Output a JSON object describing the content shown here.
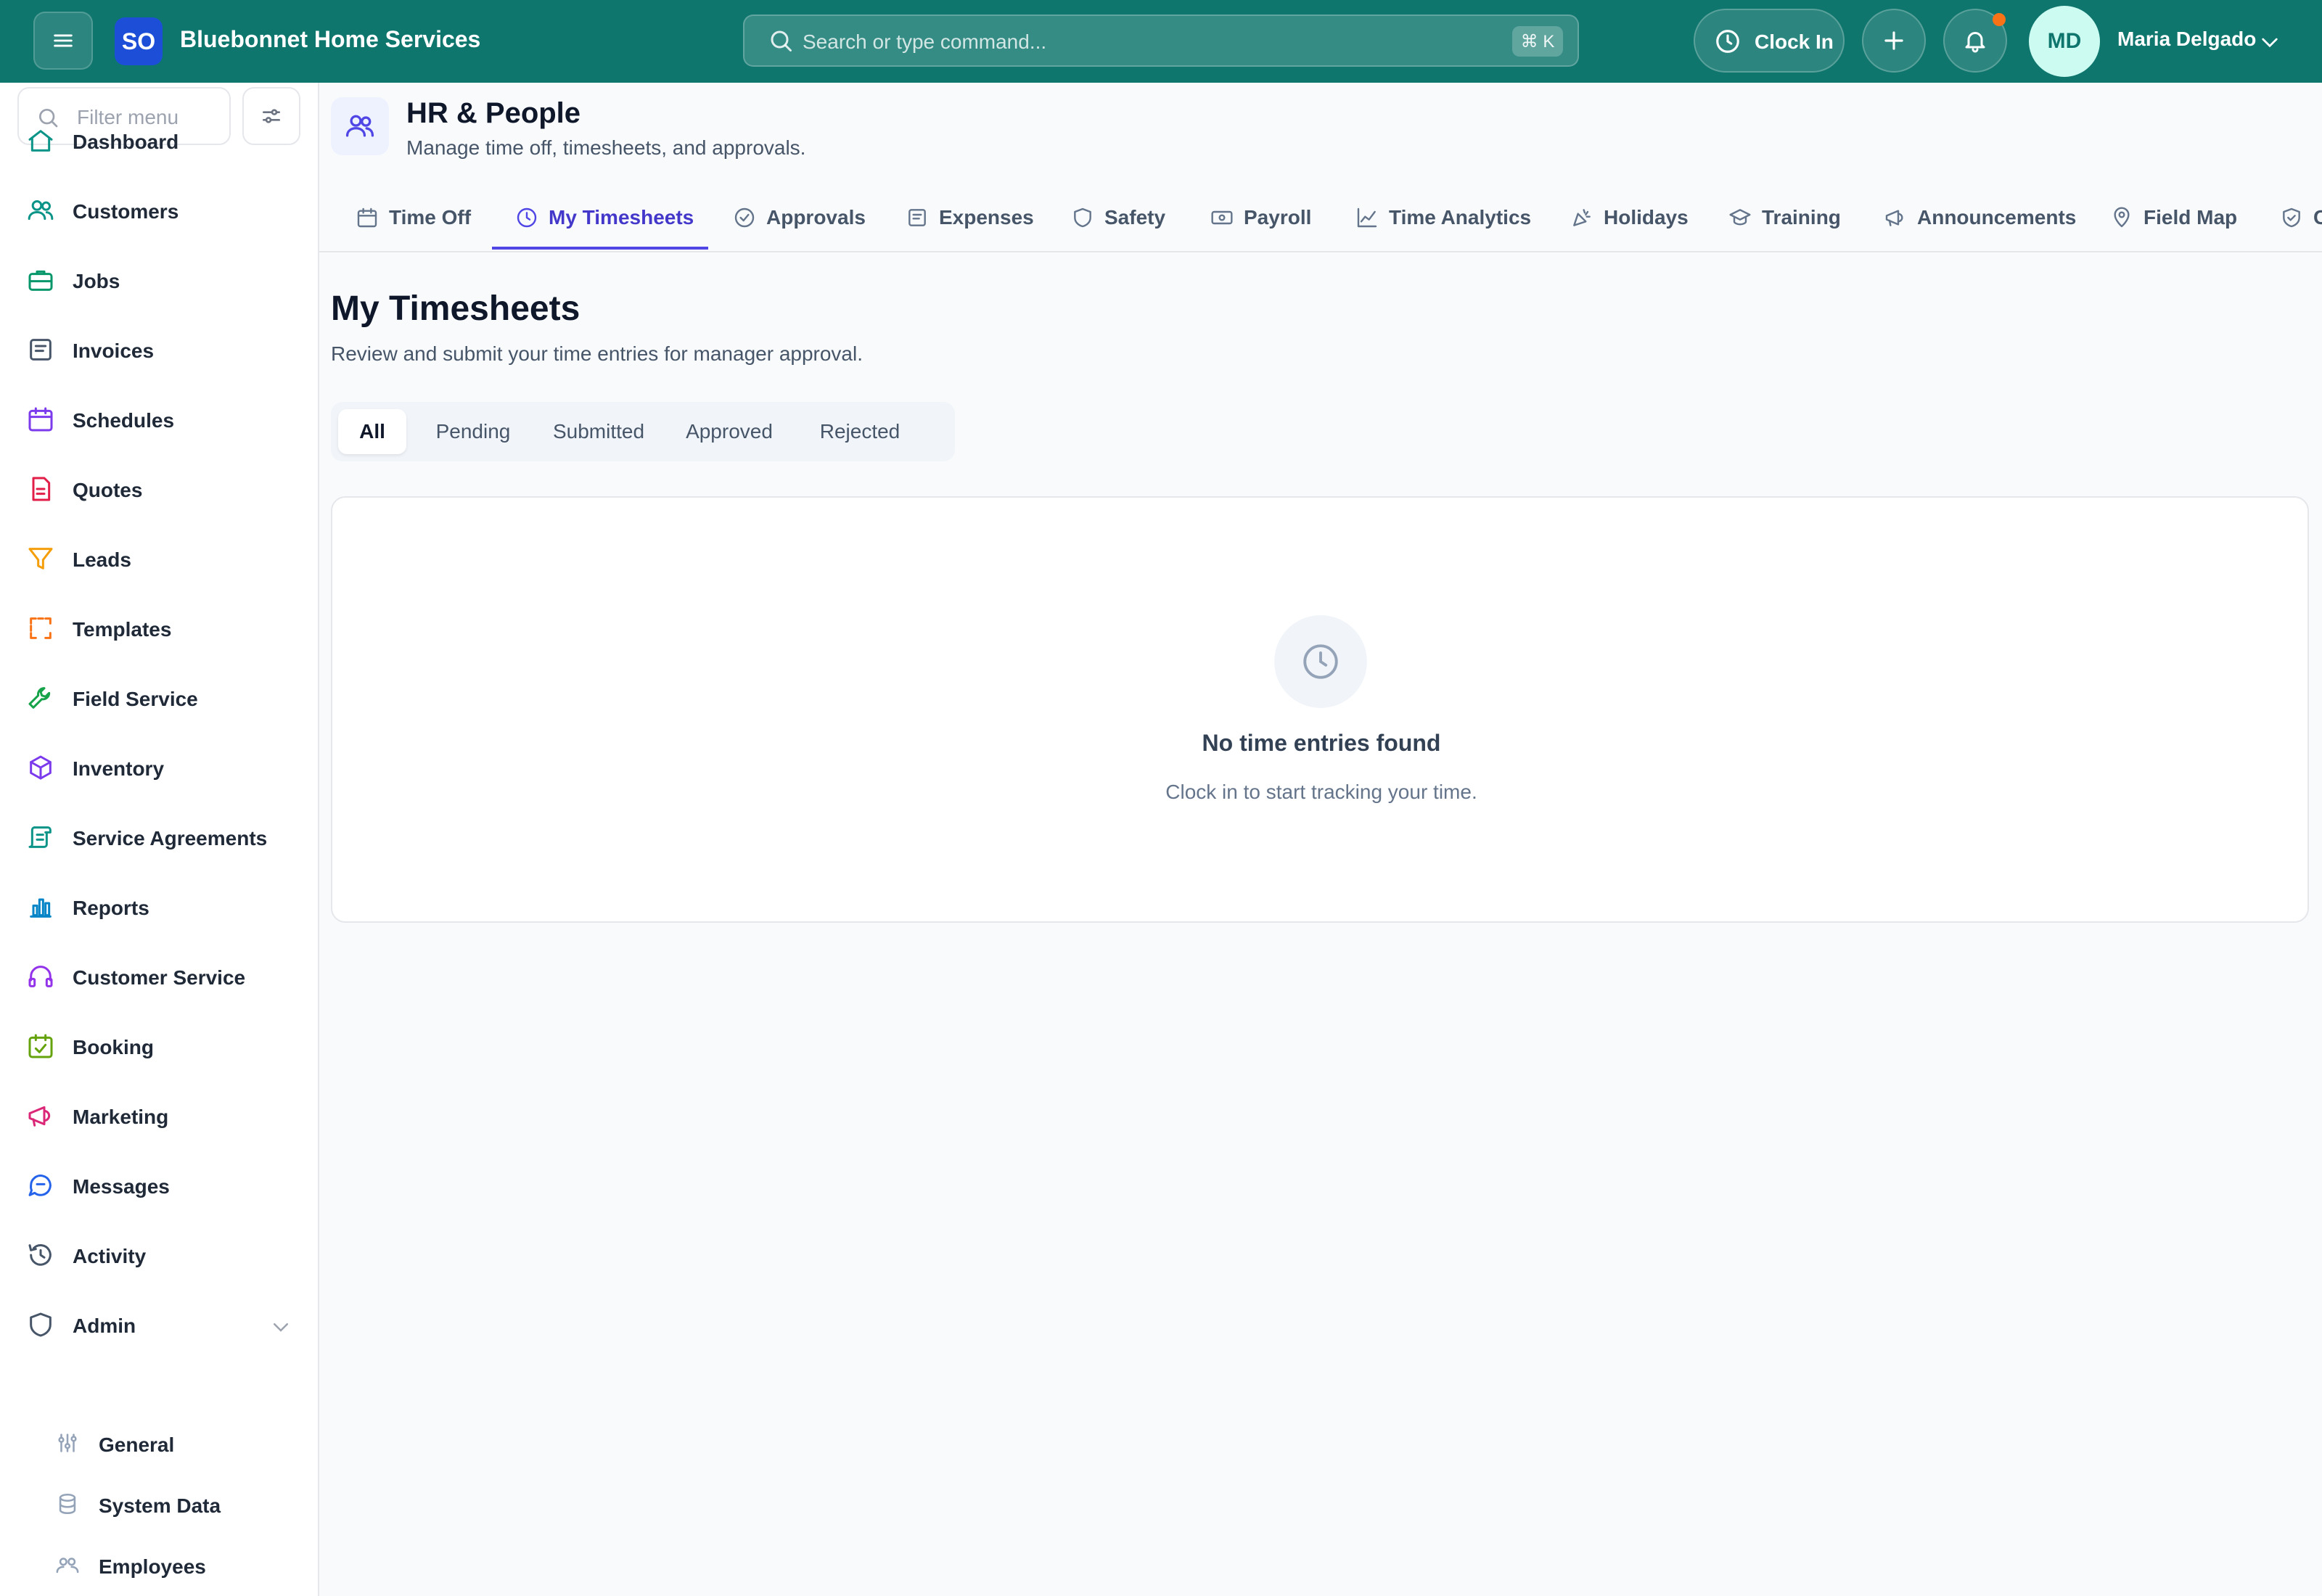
{
  "brand": {
    "initials": "SO",
    "name": "Bluebonnet Home Services"
  },
  "search": {
    "placeholder": "Search or type command...",
    "shortcut": "⌘ K"
  },
  "header": {
    "clock_in_label": "Clock In",
    "user": {
      "initials": "MD",
      "name": "Maria Delgado"
    },
    "has_notification": true
  },
  "sidebar": {
    "filter_placeholder": "Filter menu",
    "items": [
      {
        "label": "Dashboard",
        "icon": "home-icon",
        "color": "#0d9488"
      },
      {
        "label": "Customers",
        "icon": "users-icon",
        "color": "#0d9488"
      },
      {
        "label": "Jobs",
        "icon": "briefcase-icon",
        "color": "#059669"
      },
      {
        "label": "Invoices",
        "icon": "receipt-icon",
        "color": "#475569"
      },
      {
        "label": "Schedules",
        "icon": "calendar-icon",
        "color": "#7c3aed"
      },
      {
        "label": "Quotes",
        "icon": "file-icon",
        "color": "#e11d48"
      },
      {
        "label": "Leads",
        "icon": "funnel-icon",
        "color": "#f59e0b"
      },
      {
        "label": "Templates",
        "icon": "template-icon",
        "color": "#f97316"
      },
      {
        "label": "Field Service",
        "icon": "wrench-icon",
        "color": "#16a34a"
      },
      {
        "label": "Inventory",
        "icon": "box-icon",
        "color": "#7c3aed"
      },
      {
        "label": "Service Agreements",
        "icon": "scroll-icon",
        "color": "#0d9488"
      },
      {
        "label": "Reports",
        "icon": "bar-chart-icon",
        "color": "#0284c7"
      },
      {
        "label": "Customer Service",
        "icon": "headset-icon",
        "color": "#9333ea"
      },
      {
        "label": "Booking",
        "icon": "calendar-check-icon",
        "color": "#65a30d"
      },
      {
        "label": "Marketing",
        "icon": "megaphone-icon",
        "color": "#db2777"
      },
      {
        "label": "Messages",
        "icon": "message-icon",
        "color": "#2563eb"
      },
      {
        "label": "Activity",
        "icon": "history-icon",
        "color": "#475569"
      },
      {
        "label": "Admin",
        "icon": "shield-icon",
        "color": "#475569",
        "expanded": true
      }
    ],
    "admin_sub_items": [
      {
        "label": "General",
        "icon": "sliders-icon"
      },
      {
        "label": "System Data",
        "icon": "database-icon"
      },
      {
        "label": "Employees",
        "icon": "people-icon"
      }
    ]
  },
  "page": {
    "title": "HR & People",
    "subtitle": "Manage time off, timesheets, and approvals.",
    "tabs": [
      {
        "label": "Time Off",
        "icon": "calendar-icon"
      },
      {
        "label": "My Timesheets",
        "icon": "clock-icon",
        "active": true
      },
      {
        "label": "Approvals",
        "icon": "check-circle-icon"
      },
      {
        "label": "Expenses",
        "icon": "receipt-icon"
      },
      {
        "label": "Safety",
        "icon": "shield-icon"
      },
      {
        "label": "Payroll",
        "icon": "banknote-icon"
      },
      {
        "label": "Time Analytics",
        "icon": "line-chart-icon"
      },
      {
        "label": "Holidays",
        "icon": "party-icon"
      },
      {
        "label": "Training",
        "icon": "graduation-cap-icon"
      },
      {
        "label": "Announcements",
        "icon": "megaphone-icon"
      },
      {
        "label": "Field Map",
        "icon": "map-pin-icon"
      },
      {
        "label": "C",
        "icon": "shield-check-icon"
      }
    ]
  },
  "timesheets": {
    "title": "My Timesheets",
    "subtitle": "Review and submit your time entries for manager approval.",
    "filters": [
      "All",
      "Pending",
      "Submitted",
      "Approved",
      "Rejected"
    ],
    "active_filter": "All",
    "empty": {
      "title": "No time entries found",
      "subtitle": "Clock in to start tracking your time."
    }
  }
}
